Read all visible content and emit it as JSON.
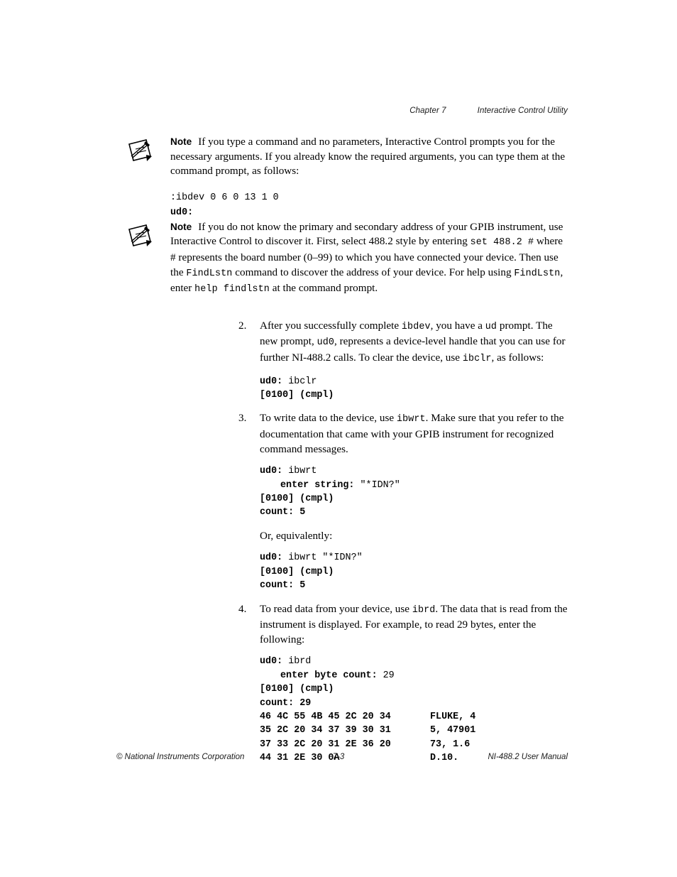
{
  "header": {
    "chapter": "Chapter 7",
    "title": "Interactive Control Utility"
  },
  "notes": [
    {
      "icon": "note-pencil-icon",
      "label": "Note",
      "text_segments": [
        {
          "t": "If you type a command and no parameters, Interactive Control prompts you for the necessary arguments. If you already know the required arguments, you can type them at the command prompt, as follows:",
          "style": "normal"
        }
      ],
      "code_lines": [
        {
          "parts": [
            {
              "t": ":ibdev 0 6 0 13 1 0",
              "style": "normal"
            }
          ]
        },
        {
          "parts": [
            {
              "t": "ud0:",
              "style": "bold"
            }
          ]
        }
      ]
    },
    {
      "icon": "note-pencil-icon",
      "label": "Note",
      "text_segments": [
        {
          "t": "If you do not know the primary and secondary address of your GPIB instrument, use Interactive Control to discover it. First, select 488.2 style by entering ",
          "style": "normal"
        },
        {
          "t": "set 488.2 #",
          "style": "mono"
        },
        {
          "t": " where # represents the board number (0–99) to which you have connected your device. Then use the ",
          "style": "normal"
        },
        {
          "t": "FindLstn",
          "style": "mono"
        },
        {
          "t": " command to discover the address of your device. For help using ",
          "style": "normal"
        },
        {
          "t": "FindLstn",
          "style": "mono"
        },
        {
          "t": ", enter ",
          "style": "normal"
        },
        {
          "t": "help findlstn",
          "style": "mono"
        },
        {
          "t": " at the command prompt.",
          "style": "normal"
        }
      ],
      "code_lines": []
    }
  ],
  "steps": [
    {
      "number": "2.",
      "text_segments": [
        {
          "t": "After you successfully complete ",
          "style": "normal"
        },
        {
          "t": "ibdev",
          "style": "mono"
        },
        {
          "t": ", you have a ",
          "style": "normal"
        },
        {
          "t": "ud",
          "style": "mono"
        },
        {
          "t": " prompt. The new prompt, ",
          "style": "normal"
        },
        {
          "t": "ud0",
          "style": "mono"
        },
        {
          "t": ", represents a device-level handle that you can use for further NI-488.2 calls. To clear the device, use ",
          "style": "normal"
        },
        {
          "t": "ibclr",
          "style": "mono"
        },
        {
          "t": ", as follows:",
          "style": "normal"
        }
      ],
      "blocks": [
        {
          "kind": "code",
          "lines": [
            {
              "parts": [
                {
                  "t": "ud0:",
                  "style": "bold"
                },
                {
                  "t": " ibclr",
                  "style": "normal"
                }
              ]
            },
            {
              "parts": [
                {
                  "t": "[0100] (cmpl)",
                  "style": "bold"
                }
              ]
            }
          ]
        }
      ]
    },
    {
      "number": "3.",
      "text_segments": [
        {
          "t": "To write data to the device, use ",
          "style": "normal"
        },
        {
          "t": "ibwrt",
          "style": "mono"
        },
        {
          "t": ". Make sure that you refer to the documentation that came with your GPIB instrument for recognized command messages.",
          "style": "normal"
        }
      ],
      "blocks": [
        {
          "kind": "code",
          "lines": [
            {
              "parts": [
                {
                  "t": "ud0:",
                  "style": "bold"
                },
                {
                  "t": " ibwrt",
                  "style": "normal"
                }
              ]
            },
            {
              "parts": [
                {
                  "t": "",
                  "style": "indent"
                },
                {
                  "t": "enter string:",
                  "style": "bold"
                },
                {
                  "t": " \"*IDN?\"",
                  "style": "normal"
                }
              ]
            },
            {
              "parts": [
                {
                  "t": "[0100] (cmpl)",
                  "style": "bold"
                }
              ]
            },
            {
              "parts": [
                {
                  "t": "count: 5",
                  "style": "bold"
                }
              ]
            }
          ]
        },
        {
          "kind": "para",
          "text": "Or, equivalently:"
        },
        {
          "kind": "code",
          "lines": [
            {
              "parts": [
                {
                  "t": "ud0:",
                  "style": "bold"
                },
                {
                  "t": " ibwrt \"*IDN?\"",
                  "style": "normal"
                }
              ]
            },
            {
              "parts": [
                {
                  "t": "[0100] (cmpl)",
                  "style": "bold"
                }
              ]
            },
            {
              "parts": [
                {
                  "t": "count: 5",
                  "style": "bold"
                }
              ]
            }
          ]
        }
      ]
    },
    {
      "number": "4.",
      "text_segments": [
        {
          "t": "To read data from your device, use ",
          "style": "normal"
        },
        {
          "t": "ibrd",
          "style": "mono"
        },
        {
          "t": ". The data that is read from the instrument is displayed. For example, to read 29 bytes, enter the following:",
          "style": "normal"
        }
      ],
      "blocks": [
        {
          "kind": "code",
          "lines": [
            {
              "parts": [
                {
                  "t": "ud0:",
                  "style": "bold"
                },
                {
                  "t": " ibrd",
                  "style": "normal"
                }
              ]
            },
            {
              "parts": [
                {
                  "t": "",
                  "style": "indent"
                },
                {
                  "t": "enter byte count:",
                  "style": "bold"
                },
                {
                  "t": " 29",
                  "style": "normal"
                }
              ]
            },
            {
              "parts": [
                {
                  "t": "[0100] (cmpl)",
                  "style": "bold"
                }
              ]
            },
            {
              "parts": [
                {
                  "t": "count: 29",
                  "style": "bold"
                }
              ]
            }
          ]
        },
        {
          "kind": "hexdump",
          "rows": [
            {
              "bytes": "46 4C 55 4B 45 2C 20 34",
              "ascii": "FLUKE, 4"
            },
            {
              "bytes": "35 2C 20 34 37 39 30 31",
              "ascii": "5, 47901"
            },
            {
              "bytes": "37 33 2C 20 31 2E 36 20",
              "ascii": "73, 1.6"
            },
            {
              "bytes": "44 31 2E 30 0A",
              "ascii": "D.10."
            }
          ]
        }
      ]
    }
  ],
  "footer": {
    "left": "© National Instruments Corporation",
    "center": "7-3",
    "right": "NI-488.2 User Manual"
  }
}
